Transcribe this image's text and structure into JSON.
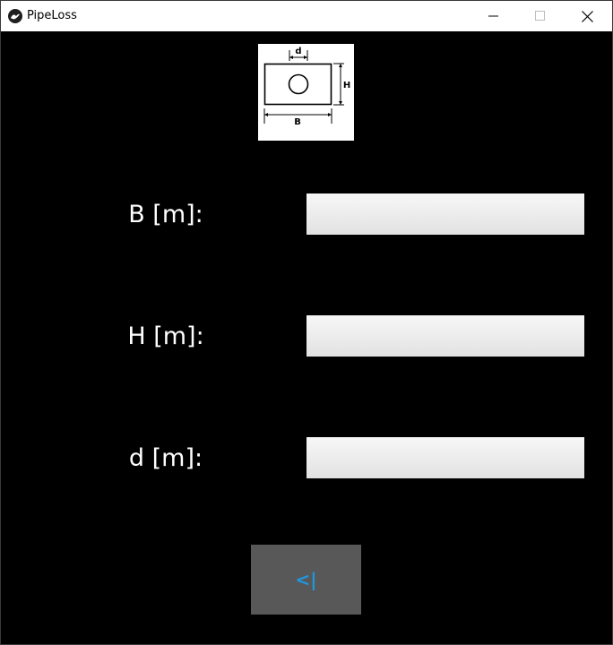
{
  "window": {
    "title": "PipeLoss"
  },
  "diagram": {
    "labels": {
      "d": "d",
      "H": "H",
      "B": "B"
    }
  },
  "form": {
    "fields": [
      {
        "label": "B [m]:",
        "value": "",
        "placeholder": ""
      },
      {
        "label": "H [m]:",
        "value": "",
        "placeholder": ""
      },
      {
        "label": "d [m]:",
        "value": "",
        "placeholder": ""
      }
    ]
  },
  "back_button": {
    "label": "<|"
  },
  "colors": {
    "background": "#000000",
    "input_bg": "#eeeeee",
    "button_bg": "#585858",
    "button_text": "#1f97de"
  }
}
